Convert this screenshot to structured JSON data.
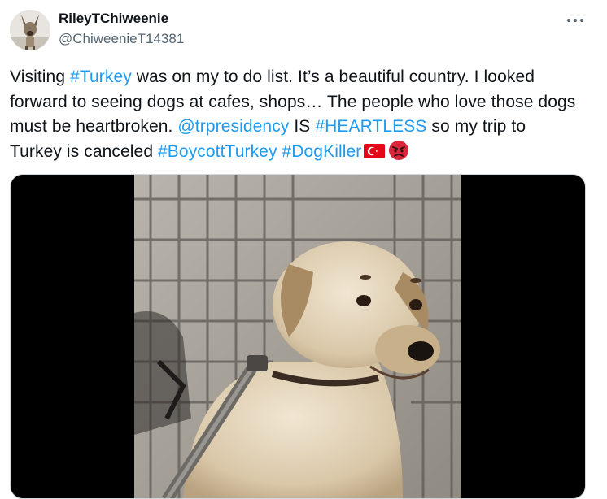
{
  "tweet": {
    "display_name": "RileyTChiweenie",
    "handle": "@ChiweenieT14381",
    "more_icon": "more-horizontal-icon",
    "text": {
      "l1_a": "Visiting ",
      "l1_tag": "#Turkey",
      "l1_b": " was on my to do list. It’s a beautiful country. I looked",
      "l2": "forward to seeing dogs at cafes, shops… The people who love those dogs",
      "l3_a": "must be heartbroken. ",
      "l3_mention": "@trpresidency",
      "l3_b": " IS ",
      "l3_tag": "#HEARTLESS",
      "l3_c": " so my trip to",
      "l4_a": "Turkey is canceled ",
      "l4_tag1": "#BoycottTurkey",
      "l4_sp": " ",
      "l4_tag2": "#DogKiller",
      "emojis": [
        "turkey-flag",
        "angry-face"
      ]
    },
    "media": {
      "type": "video",
      "subject": "dog-in-cage-image"
    },
    "colors": {
      "link": "#1d9bf0",
      "text": "#0f1419",
      "secondary": "#536471"
    }
  }
}
